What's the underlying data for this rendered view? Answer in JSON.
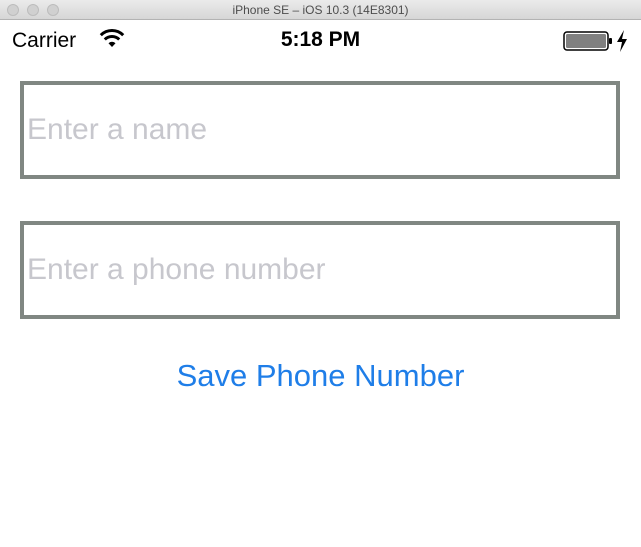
{
  "window": {
    "title": "iPhone SE – iOS 10.3 (14E8301)"
  },
  "status_bar": {
    "carrier": "Carrier",
    "time": "5:18 PM",
    "icons": [
      "wifi-icon",
      "battery-icon",
      "charging-bolt-icon"
    ]
  },
  "form": {
    "name_field": {
      "value": "",
      "placeholder": "Enter a name"
    },
    "phone_field": {
      "value": "",
      "placeholder": "Enter a phone number"
    },
    "save_label": "Save Phone Number"
  },
  "colors": {
    "accent": "#1f7ee8",
    "field_border": "#808782",
    "placeholder": "#c7c7cd"
  }
}
